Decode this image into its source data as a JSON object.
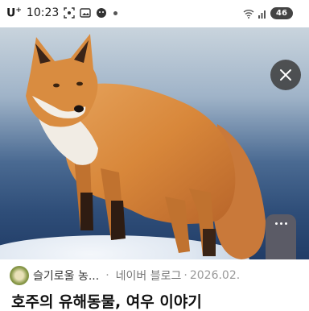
{
  "status_bar": {
    "carrier": "U",
    "carrier_sup": "+",
    "time": "10:23",
    "battery": "46"
  },
  "photo": {
    "subject_icon": "fox-photo",
    "close_icon": "close-icon",
    "more_icon": "more-icon"
  },
  "info": {
    "blog_name": "슬기로울 농...",
    "source": "네이버 블로그",
    "date": "2026.02."
  },
  "title": "호주의 유해동물, 여우 이야기",
  "colors": {
    "fox_orange": "#d8873a",
    "sky": "#9fb3c8",
    "deep_blue": "#2e4d78",
    "close_bg": "#3c3c3c"
  }
}
